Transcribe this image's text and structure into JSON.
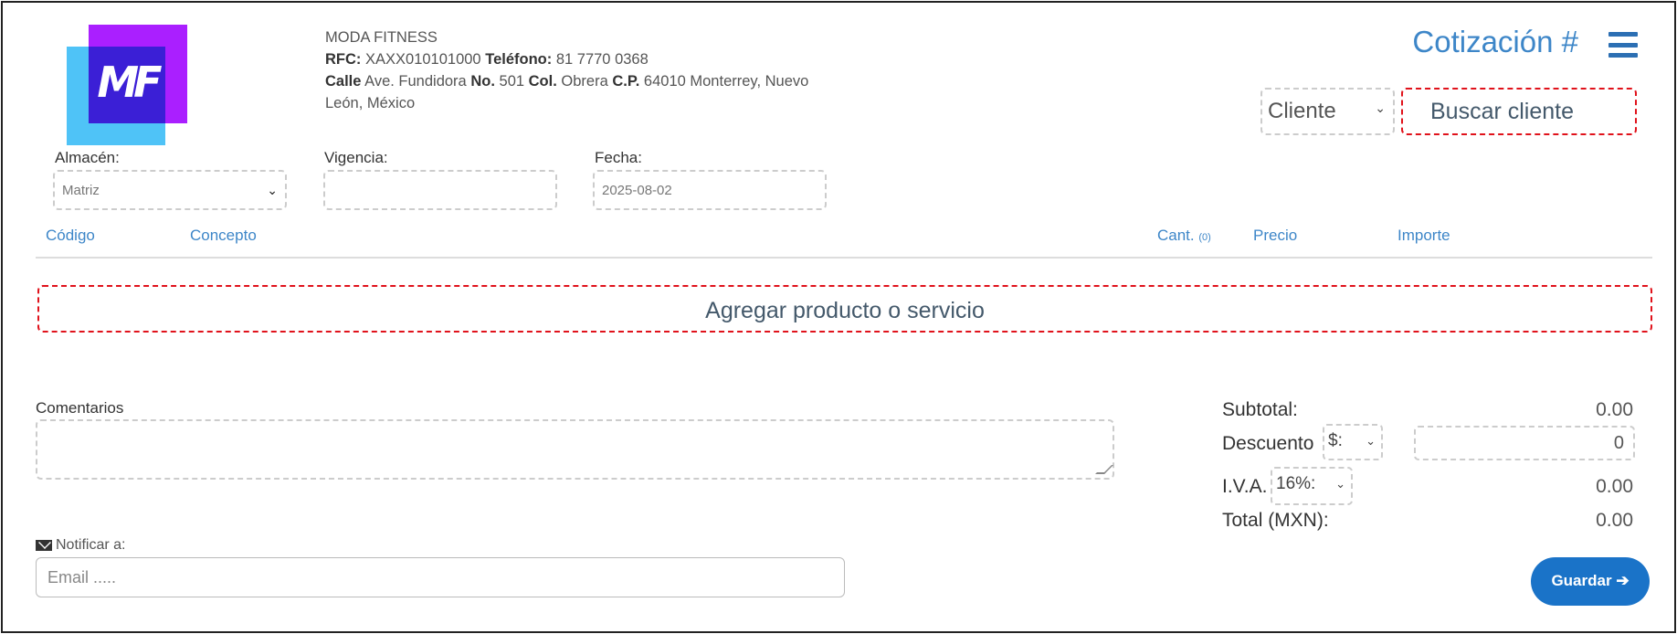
{
  "company": {
    "name": "MODA FITNESS",
    "rfc_label": "RFC:",
    "rfc": "XAXX010101000",
    "phone_label": "Teléfono:",
    "phone": "81 7770 0368",
    "street_label": "Calle",
    "street": "Ave. Fundidora",
    "number_label": "No.",
    "number": "501",
    "col_label": "Col.",
    "col": "Obrera",
    "cp_label": "C.P.",
    "cp_rest_line1": "64010 Monterrey, Nuevo",
    "cp_rest_line2": "León, México",
    "logo_text": "MF"
  },
  "header": {
    "title": "Cotización #",
    "client_select": "Cliente",
    "search_client": "Buscar cliente"
  },
  "form": {
    "almacen_label": "Almacén:",
    "almacen_value": "Matriz",
    "vigencia_label": "Vigencia:",
    "vigencia_value": "",
    "fecha_label": "Fecha:",
    "fecha_value": "2025-08-02"
  },
  "table": {
    "columns": {
      "codigo": "Código",
      "concepto": "Concepto",
      "cant": "Cant.",
      "cant_count": "(0)",
      "precio": "Precio",
      "importe": "Importe"
    },
    "add_item": "Agregar producto o servicio"
  },
  "comments": {
    "label": "Comentarios",
    "value": ""
  },
  "notify": {
    "label": "Notificar a:",
    "placeholder": "Email ....."
  },
  "totals": {
    "subtotal_label": "Subtotal:",
    "subtotal": "0.00",
    "descuento_label": "Descuento",
    "descuento_type": "$:",
    "descuento_value": "0",
    "iva_label": "I.V.A.",
    "iva_rate": "16%:",
    "iva": "0.00",
    "total_label": "Total (MXN):",
    "total": "0.00"
  },
  "actions": {
    "save": "Guardar",
    "save_arrow": "➔"
  },
  "colors": {
    "accent": "#3d86c8",
    "button": "#1a73c8",
    "required_border": "#e0121b"
  }
}
